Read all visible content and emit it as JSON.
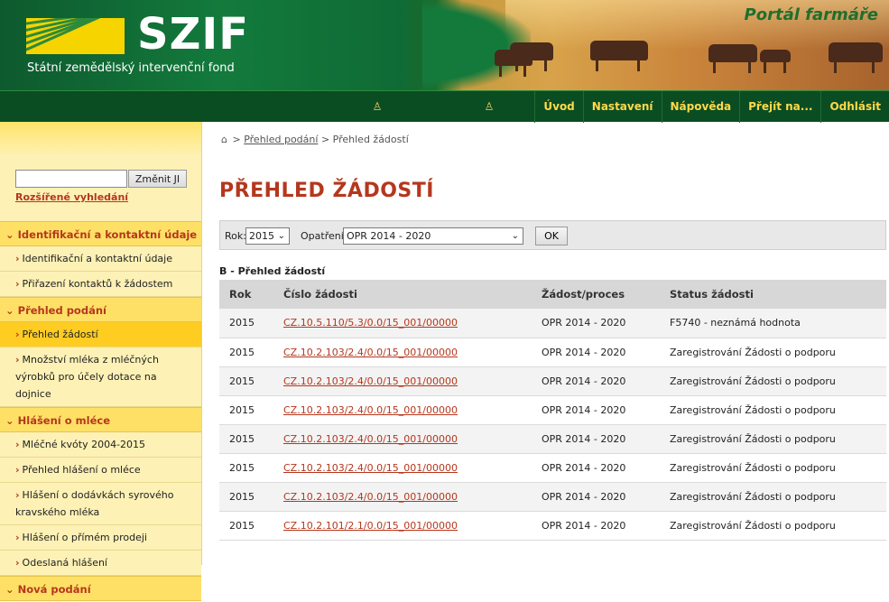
{
  "header": {
    "logo_text": "SZIF",
    "logo_subtitle": "Státní zemědělský intervenční fond",
    "portal_title": "Portál farmáře"
  },
  "navbar": {
    "menu": [
      "Úvod",
      "Nastavení",
      "Nápověda",
      "Přejít na...",
      "Odhlásit"
    ]
  },
  "sidebar": {
    "search_button": "Změnit JI",
    "search_value": "",
    "advanced_search": "Rozšířené vyhledání",
    "sections": [
      {
        "title": "Identifikační a kontaktní údaje",
        "items": [
          "Identifikační a kontaktní údaje",
          "Přiřazení kontaktů k žádostem"
        ]
      },
      {
        "title": "Přehled podání",
        "items": [
          "Přehled žádostí",
          "Množství mléka z mléčných výrobků pro účely dotace na dojnice"
        ]
      },
      {
        "title": "Hlášení o mléce",
        "items": [
          "Mléčné kvóty 2004-2015",
          "Přehled hlášení o mléce",
          "Hlášení o dodávkách syrového kravského mléka",
          "Hlášení o přímém prodeji",
          "Odeslaná hlášení"
        ]
      },
      {
        "title": "Nová podání",
        "items": []
      }
    ],
    "active_item": "Přehled žádostí"
  },
  "breadcrumb": {
    "link": "Přehled podání",
    "current": "Přehled žádostí",
    "separator": ">"
  },
  "page_title": "PŘEHLED ŽÁDOSTÍ",
  "filter": {
    "year_label": "Rok:",
    "year_value": "2015",
    "measure_label": "Opatření:",
    "measure_value": "OPR 2014 - 2020",
    "ok_label": "OK"
  },
  "table": {
    "caption": "B - Přehled žádostí",
    "columns": [
      "Rok",
      "Číslo žádosti",
      "Žádost/proces",
      "Status žádosti"
    ],
    "rows": [
      [
        "2015",
        "CZ.10.5.110/5.3/0.0/15_001/00000",
        "OPR 2014 - 2020",
        "F5740 - neznámá hodnota"
      ],
      [
        "2015",
        "CZ.10.2.103/2.4/0.0/15_001/00000",
        "OPR 2014 - 2020",
        "Zaregistrování Žádosti o podporu"
      ],
      [
        "2015",
        "CZ.10.2.103/2.4/0.0/15_001/00000",
        "OPR 2014 - 2020",
        "Zaregistrování Žádosti o podporu"
      ],
      [
        "2015",
        "CZ.10.2.103/2.4/0.0/15_001/00000",
        "OPR 2014 - 2020",
        "Zaregistrování Žádosti o podporu"
      ],
      [
        "2015",
        "CZ.10.2.103/2.4/0.0/15_001/00000",
        "OPR 2014 - 2020",
        "Zaregistrování Žádosti o podporu"
      ],
      [
        "2015",
        "CZ.10.2.103/2.4/0.0/15_001/00000",
        "OPR 2014 - 2020",
        "Zaregistrování Žádosti o podporu"
      ],
      [
        "2015",
        "CZ.10.2.103/2.4/0.0/15_001/00000",
        "OPR 2014 - 2020",
        "Zaregistrování Žádosti o podporu"
      ],
      [
        "2015",
        "CZ.10.2.101/2.1/0.0/15_001/00000",
        "OPR 2014 - 2020",
        "Zaregistrování Žádosti o podporu"
      ]
    ]
  },
  "colors": {
    "brand_green": "#0b4d22",
    "accent_red": "#b5371d",
    "nav_text": "#ffd94a",
    "sidebar_bg": "#fdf1b5",
    "active_item_bg": "#ffcc22"
  },
  "icons": {
    "home": "home-icon",
    "user": "user-icon",
    "chevron": "chevron-down-icon",
    "arrow": "arrow-right-icon"
  }
}
